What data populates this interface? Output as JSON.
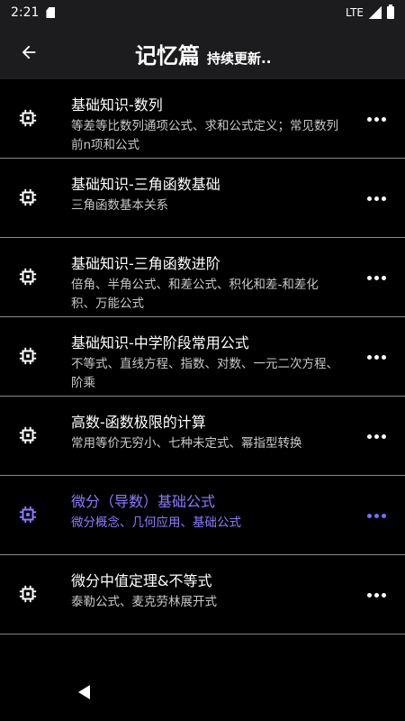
{
  "status": {
    "time": "2:21",
    "network": "LTE"
  },
  "header": {
    "title": "记忆篇",
    "subtitle": "持续更新.."
  },
  "items": [
    {
      "title": "基础知识-数列",
      "desc": "等差等比数列通项公式、求和公式定义；常见数列前n项和公式"
    },
    {
      "title": "基础知识-三角函数基础",
      "desc": "三角函数基本关系"
    },
    {
      "title": "基础知识-三角函数进阶",
      "desc": "倍角、半角公式、和差公式、积化和差-和差化积、万能公式"
    },
    {
      "title": "基础知识-中学阶段常用公式",
      "desc": "不等式、直线方程、指数、对数、一元二次方程、阶乘"
    },
    {
      "title": "高数-函数极限的计算",
      "desc": "常用等价无穷小、七种未定式、幂指型转换"
    },
    {
      "title": "微分（导数）基础公式",
      "desc": "微分概念、几何应用、基础公式",
      "active": true
    },
    {
      "title": "微分中值定理&不等式",
      "desc": "泰勒公式、麦克劳林展开式"
    }
  ],
  "colors": {
    "accent": "#8b7bff",
    "bar_bg": "#1c1c1e",
    "divider": "#8a8a8a"
  }
}
